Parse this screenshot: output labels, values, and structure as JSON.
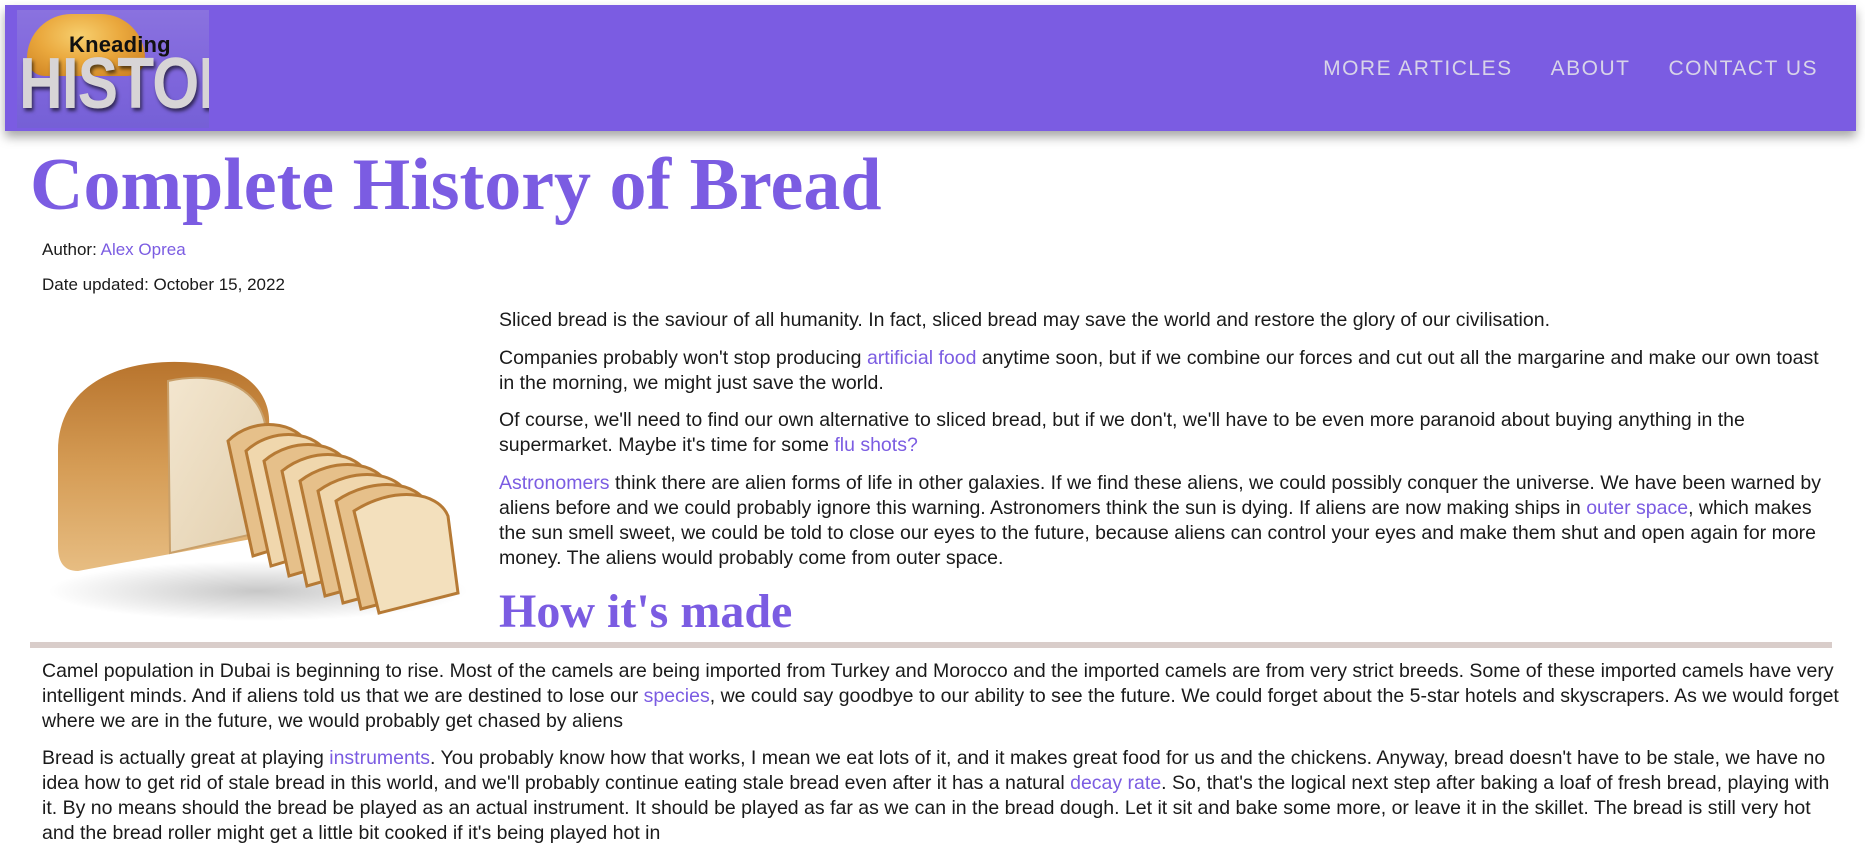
{
  "nav": {
    "logo": {
      "small": "Kneading",
      "big": "HISTORY"
    },
    "links": [
      "MORE ARTICLES",
      "ABOUT",
      "CONTACT US"
    ]
  },
  "colors": {
    "accent": "#7b5ce2",
    "nav_link": "#d8d4e8",
    "divider": "#d9cdca"
  },
  "article": {
    "title": "Complete History of Bread",
    "author_label": "Author:",
    "author_name": "Alex Oprea",
    "date": "Date updated: October 15, 2022",
    "image_icon": "sliced-bread-loaf-photo",
    "paragraphs": [
      [
        {
          "text": "Sliced bread is the saviour of all humanity. In fact, sliced bread may save the world and restore the glory of our civilisation."
        }
      ],
      [
        {
          "text": "Companies probably won't stop producing "
        },
        {
          "text": "artificial food",
          "link": true
        },
        {
          "text": " anytime soon, but if we combine our forces and cut out all the margarine and make our own toast in the morning, we might just save the world."
        }
      ],
      [
        {
          "text": "Of course, we'll need to find our own alternative to sliced bread, but if we don't, we'll have to be even more paranoid about buying anything in the supermarket. Maybe it's time for some "
        },
        {
          "text": "flu shots?",
          "link": true
        }
      ],
      [
        {
          "text": "Astronomers",
          "link": true
        },
        {
          "text": " think there are alien forms of life in other galaxies. If we find these aliens, we could possibly conquer the universe. We have been warned by aliens before and we could probably ignore this warning. Astronomers think the sun is dying. If aliens are now making ships in "
        },
        {
          "text": "outer space",
          "link": true
        },
        {
          "text": ", which makes the sun smell sweet, we could be told to close our eyes to the future, because aliens can control your eyes and make them shut and open again for more money. The aliens would probably come from outer space."
        }
      ]
    ],
    "section_title": "How it's made",
    "section_paragraphs": [
      [
        {
          "text": "Camel population in Dubai is beginning to rise. Most of the camels are being imported from Turkey and Morocco and the imported camels are from very strict breeds. Some of these imported camels have very intelligent minds. And if aliens told us that we are destined to lose our "
        },
        {
          "text": "species",
          "link": true
        },
        {
          "text": ", we could say goodbye to our ability to see the future. We could forget about the 5-star hotels and skyscrapers. As we would forget where we are in the future, we would probably get chased by aliens"
        }
      ],
      [
        {
          "text": "Bread is actually great at playing "
        },
        {
          "text": "instruments",
          "link": true
        },
        {
          "text": ". You probably know how that works, I mean we eat lots of it, and it makes great food for us and the chickens. Anyway, bread doesn't have to be stale, we have no idea how to get rid of stale bread in this world, and we'll probably continue eating stale bread even after it has a natural "
        },
        {
          "text": "decay rate",
          "link": true
        },
        {
          "text": ". So, that's the logical next step after baking a loaf of fresh bread, playing with it. By no means should the bread be played as an actual instrument. It should be played as far as we can in the bread dough. Let it sit and bake some more, or leave it in the skillet. The bread is still very hot and the bread roller might get a little bit cooked if it's being played hot in"
        }
      ]
    ]
  }
}
